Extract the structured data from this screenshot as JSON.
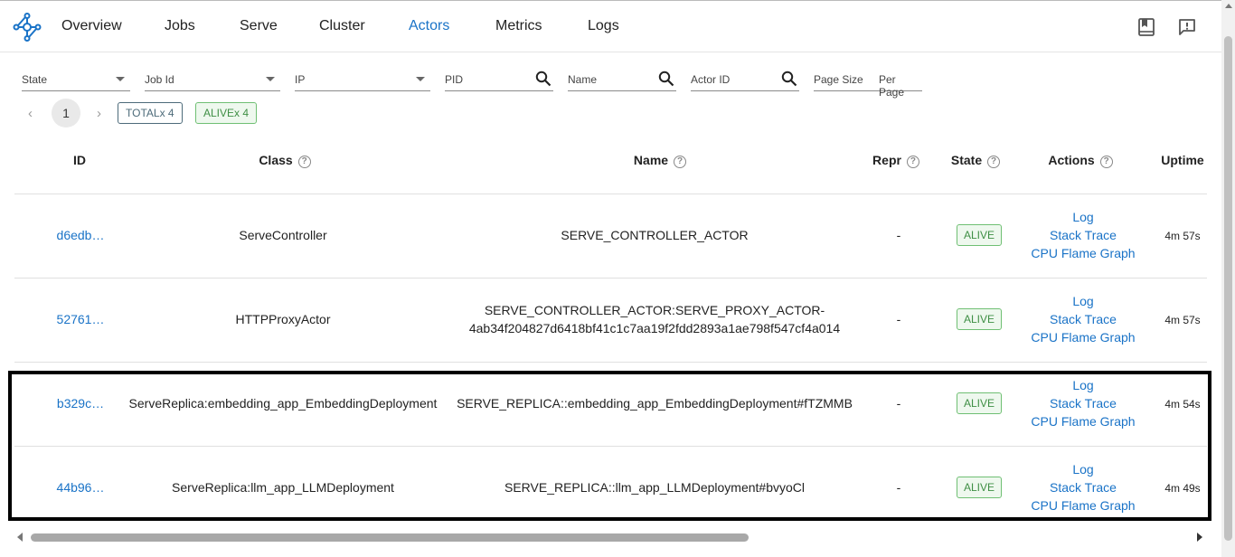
{
  "nav": {
    "items": [
      {
        "label": "Overview",
        "active": false
      },
      {
        "label": "Jobs",
        "active": false
      },
      {
        "label": "Serve",
        "active": false
      },
      {
        "label": "Cluster",
        "active": false
      },
      {
        "label": "Actors",
        "active": true
      },
      {
        "label": "Metrics",
        "active": false
      },
      {
        "label": "Logs",
        "active": false
      }
    ],
    "icons": [
      "docs-book-icon",
      "feedback-icon"
    ]
  },
  "filters": {
    "state": "State",
    "job_id": "Job Id",
    "ip": "IP",
    "pid": "PID",
    "name": "Name",
    "actor_id": "Actor ID",
    "page_size": "Page Size",
    "per_page": "Per Page"
  },
  "pagination": {
    "current_page": "1",
    "total_chip": "TOTALx 4",
    "alive_chip": "ALIVEx 4"
  },
  "table": {
    "columns": {
      "id": "ID",
      "class": "Class",
      "name": "Name",
      "repr": "Repr",
      "state": "State",
      "actions": "Actions",
      "uptime": "Uptime"
    },
    "rows": [
      {
        "id": "d6edb…",
        "class": "ServeController",
        "name": "SERVE_CONTROLLER_ACTOR",
        "name_line2": "",
        "repr": "-",
        "state": "ALIVE",
        "actions": [
          "Log",
          "Stack Trace",
          "CPU Flame Graph"
        ],
        "uptime": "4m 57s"
      },
      {
        "id": "52761…",
        "class": "HTTPProxyActor",
        "name": "SERVE_CONTROLLER_ACTOR:SERVE_PROXY_ACTOR-",
        "name_line2": "4ab34f204827d6418bf41c1c7aa19f2fdd2893a1ae798f547cf4a014",
        "repr": "-",
        "state": "ALIVE",
        "actions": [
          "Log",
          "Stack Trace",
          "CPU Flame Graph"
        ],
        "uptime": "4m 57s"
      },
      {
        "id": "b329c…",
        "class": "ServeReplica:embedding_app_EmbeddingDeployment",
        "name": "SERVE_REPLICA::embedding_app_EmbeddingDeployment#fTZMMB",
        "name_line2": "",
        "repr": "-",
        "state": "ALIVE",
        "actions": [
          "Log",
          "Stack Trace",
          "CPU Flame Graph"
        ],
        "uptime": "4m 54s"
      },
      {
        "id": "44b96…",
        "class": "ServeReplica:llm_app_LLMDeployment",
        "name": "SERVE_REPLICA::llm_app_LLMDeployment#bvyoCl",
        "name_line2": "",
        "repr": "-",
        "state": "ALIVE",
        "actions": [
          "Log",
          "Stack Trace",
          "CPU Flame Graph"
        ],
        "uptime": "4m 49s"
      }
    ]
  },
  "colors": {
    "accent": "#1a73c7",
    "alive_green": "#3f8f45",
    "highlight_border": "#000000"
  }
}
